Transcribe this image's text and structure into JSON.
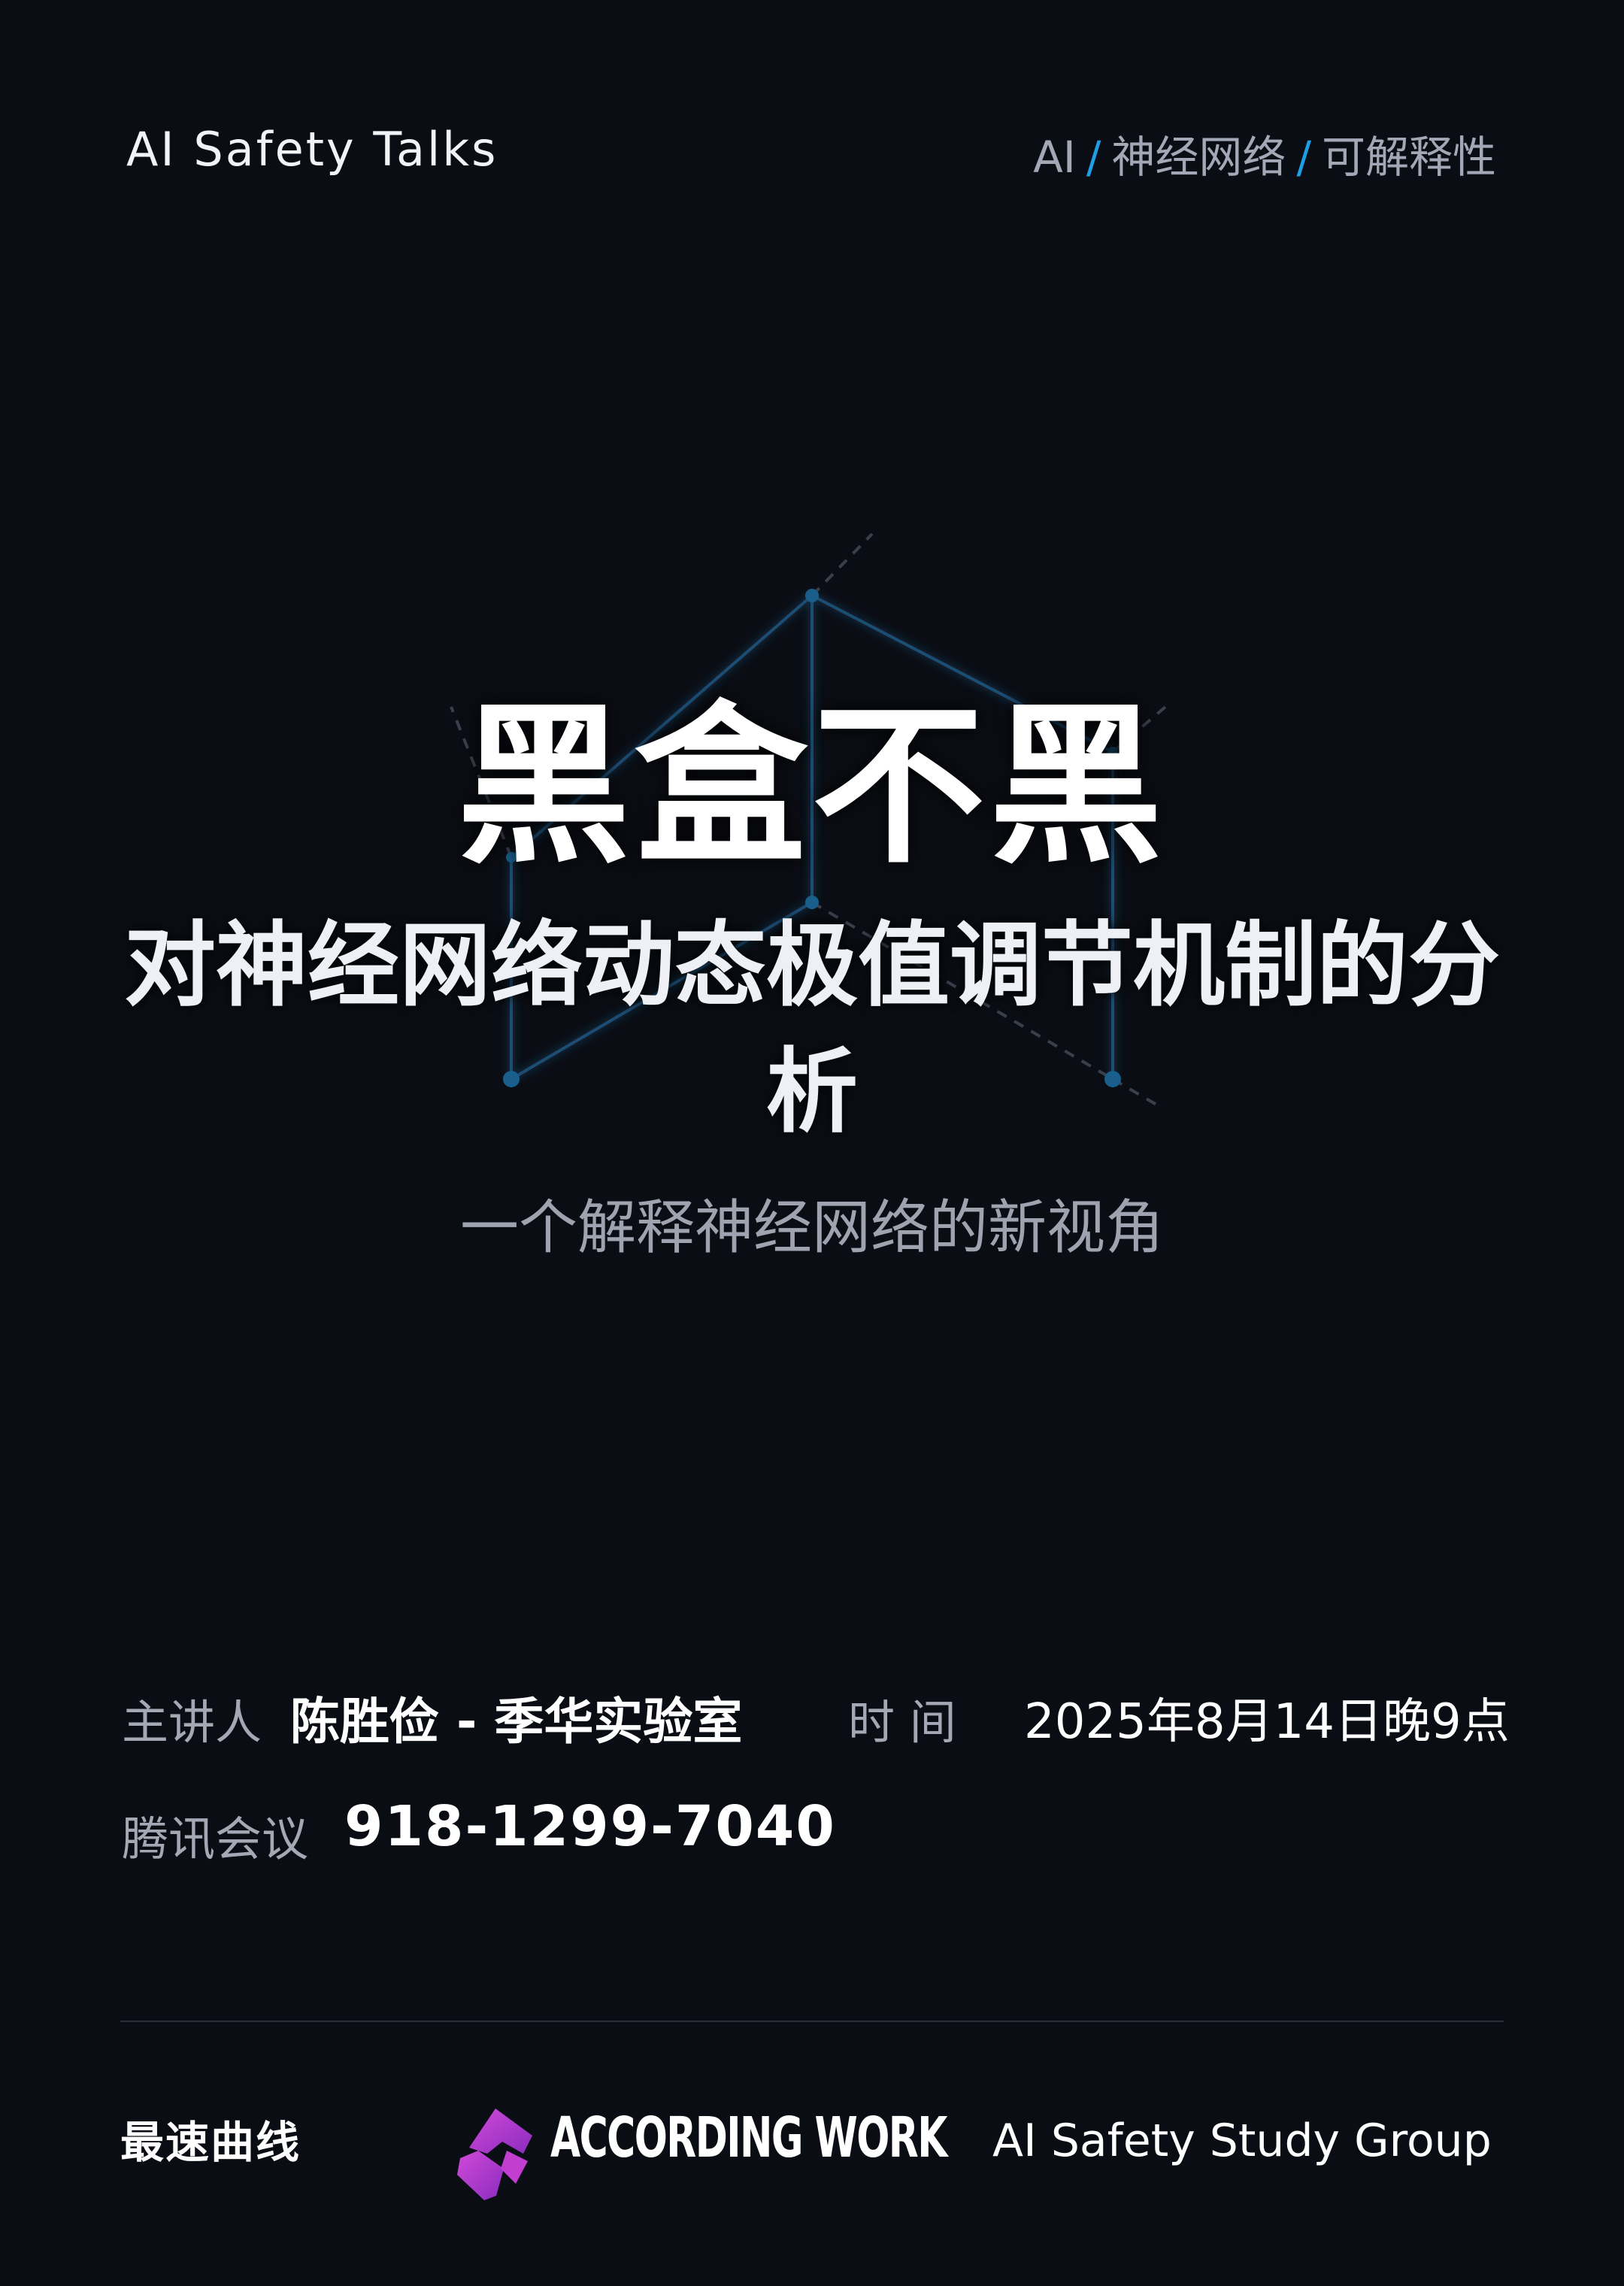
{
  "header": {
    "brand": "AI Safety Talks",
    "breadcrumbs": [
      "AI",
      "神经网络",
      "可解释性"
    ],
    "separator": "/"
  },
  "title": {
    "main": "黑盒不黑",
    "sub": "对神经网络动态极值调节机制的分析",
    "tagline": "一个解释神经网络的新视角"
  },
  "info": {
    "speaker_label": "主讲人",
    "speaker_value": "陈胜俭 - 季华实验室",
    "time_label": "时 间",
    "time_value": "2025年8月14日晚9点",
    "meeting_label": "腾讯会议",
    "meeting_value": "918-1299-7040"
  },
  "footer": {
    "left_brand": "最速曲线",
    "middle_brand": "ACCORDING WORK",
    "right_brand": "AI Safety Study Group"
  },
  "colors": {
    "background": "#0b0d14",
    "accent": "#1d9fe6",
    "network_line": "#1a4d73",
    "logo_magenta": "#b23ac8"
  }
}
